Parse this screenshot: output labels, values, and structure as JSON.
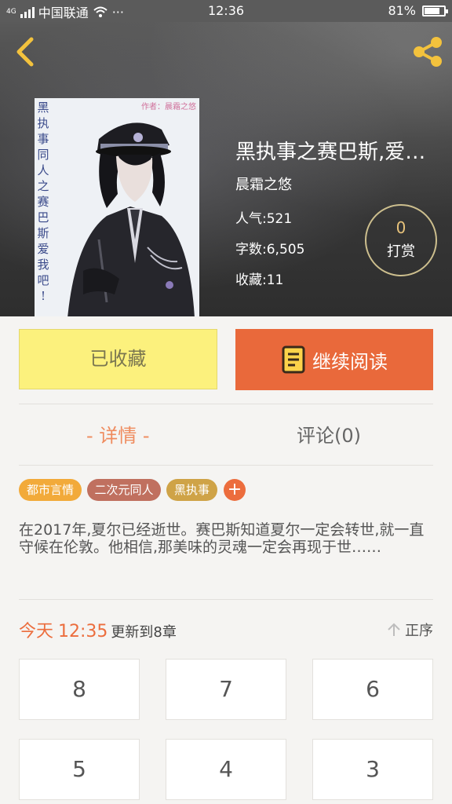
{
  "status_bar": {
    "network_type": "4G",
    "carrier": "中国联通",
    "dots": "···",
    "time": "12:36",
    "battery": "81%",
    "battery_level": 0.81
  },
  "icons": {
    "back": "chevron-left-icon",
    "share": "share-icon",
    "book": "book-icon",
    "sort": "arrow-up-icon"
  },
  "colors": {
    "accent": "#ec6d3d",
    "collect_bg": "#fcf17d",
    "read_bg": "#e9693b"
  },
  "book": {
    "cover_title_vertical": [
      "黑",
      "执",
      "事",
      "同",
      "人",
      "之",
      "赛",
      "巴",
      "斯",
      "爱",
      "我",
      "吧",
      "!"
    ],
    "cover_signature": "作者：晨霜之悠",
    "title": "黑执事之赛巴斯,爱…",
    "author": "晨霜之悠",
    "popularity": "人气:521",
    "word_count": "字数:6,505",
    "favorites": "收藏:11"
  },
  "reward": {
    "count": "0",
    "label": "打赏"
  },
  "actions": {
    "collected": "已收藏",
    "continue_reading": "继续阅读"
  },
  "tabs": {
    "detail": "- 详情 -",
    "comments": "评论(0)"
  },
  "tags": [
    "都市言情",
    "二次元同人",
    "黑执事"
  ],
  "add_tag": "+",
  "description": "在2017年,夏尔已经逝世。赛巴斯知道夏尔一定会转世,就一直守候在伦敦。他相信,那美味的灵魂一定会再现于世……",
  "update": {
    "today": "今天",
    "time": "12:35",
    "text": "更新到8章"
  },
  "sort_label": "正序",
  "chapters": [
    "8",
    "7",
    "6",
    "5",
    "4",
    "3"
  ]
}
